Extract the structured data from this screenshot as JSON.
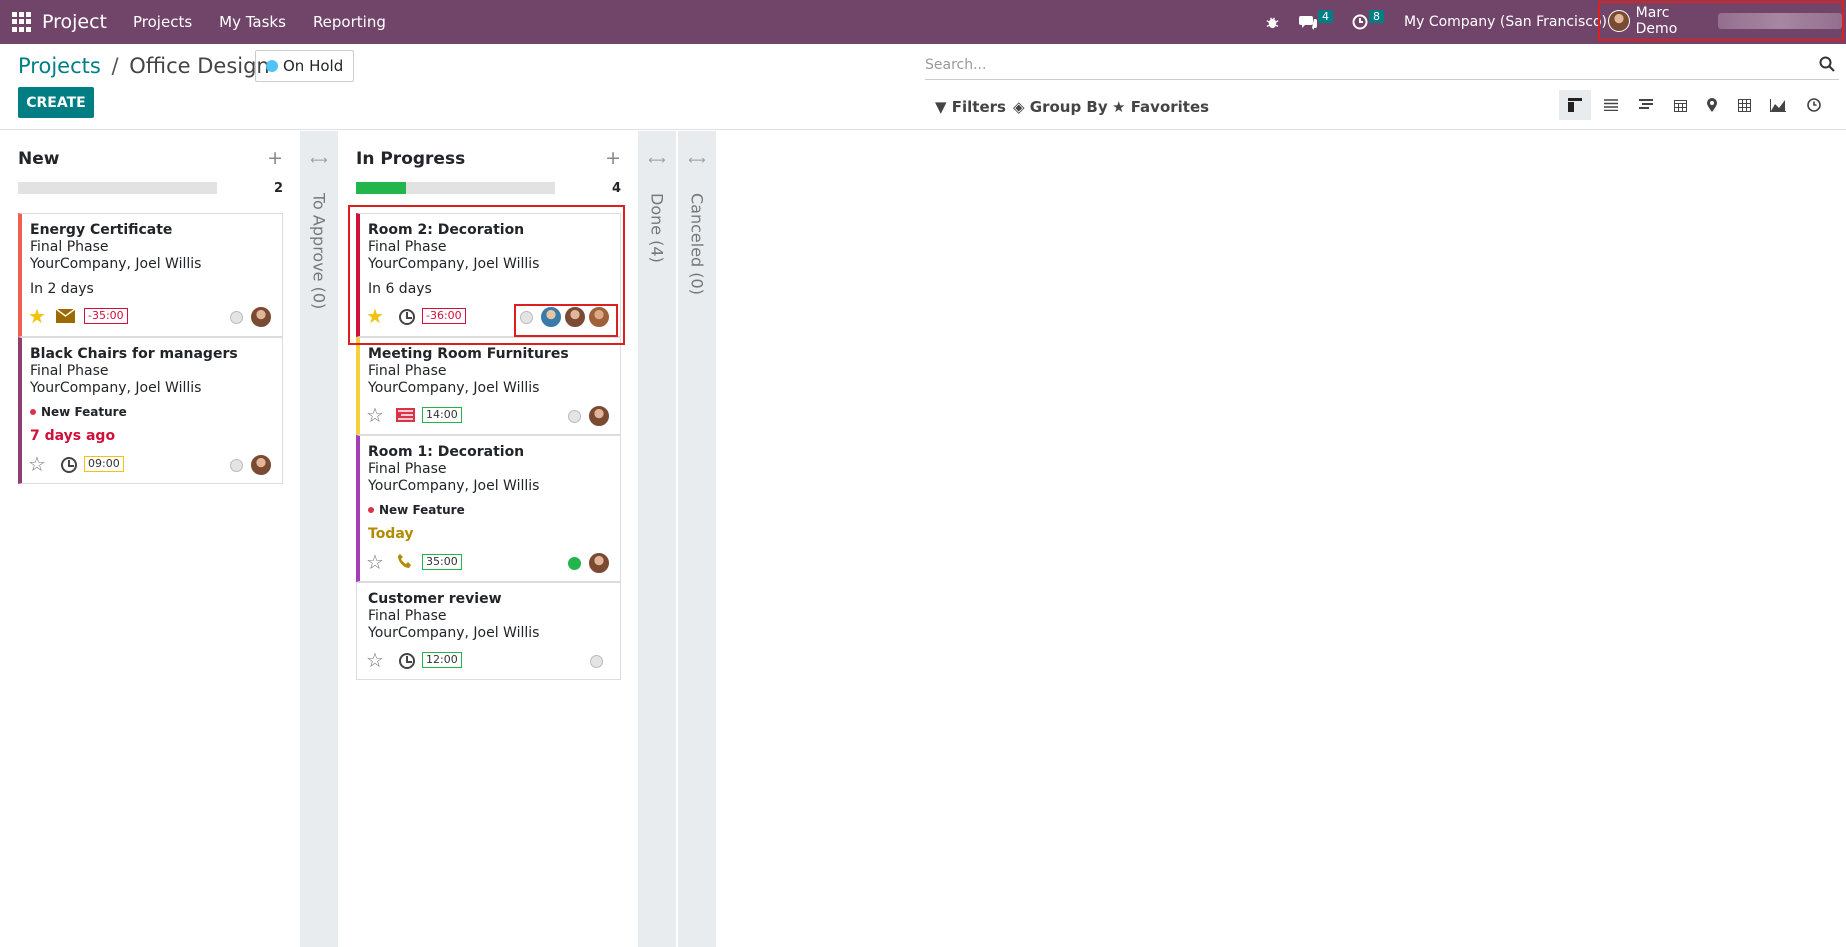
{
  "topbar": {
    "app_name": "Project",
    "menu": [
      "Projects",
      "My Tasks",
      "Reporting"
    ],
    "messages_count": "4",
    "activities_count": "8",
    "company": "My Company (San Francisco)",
    "user": "Marc Demo"
  },
  "control_panel": {
    "breadcrumb_root": "Projects",
    "breadcrumb_sep": "/",
    "breadcrumb_current": "Office Design",
    "status": "On Hold",
    "status_color": "#4fc3f7",
    "create_label": "CREATE",
    "search_placeholder": "Search...",
    "filters_label": "Filters",
    "groupby_label": "Group By",
    "favorites_label": "Favorites",
    "views": [
      "kanban",
      "list",
      "gantt",
      "calendar",
      "map",
      "pivot",
      "graph",
      "activity"
    ]
  },
  "columns": [
    {
      "title": "New",
      "count": "2",
      "progress_green_pct": 0
    },
    {
      "title": "To Approve (0)",
      "folded": true
    },
    {
      "title": "In Progress",
      "count": "4",
      "progress_green_pct": 25
    },
    {
      "title": "Done (4)",
      "folded": true
    },
    {
      "title": "Canceled (0)",
      "folded": true
    }
  ],
  "cards": {
    "energy": {
      "title": "Energy Certificate",
      "phase": "Final Phase",
      "assignees": "YourCompany, Joel Willis",
      "deadline": "In 2 days",
      "hours": "-35:00",
      "color": "#f06050"
    },
    "chairs": {
      "title": "Black Chairs for managers",
      "phase": "Final Phase",
      "assignees": "YourCompany, Joel Willis",
      "tag": "New Feature",
      "deadline": "7 days ago",
      "hours": "09:00",
      "color": "#8e3f6f"
    },
    "room2": {
      "title": "Room 2: Decoration",
      "phase": "Final Phase",
      "assignees": "YourCompany, Joel Willis",
      "deadline": "In 6 days",
      "hours": "-36:00",
      "color": "#d0103a"
    },
    "meeting": {
      "title": "Meeting Room Furnitures",
      "phase": "Final Phase",
      "assignees": "YourCompany, Joel Willis",
      "hours": "14:00",
      "color": "#f4d03f"
    },
    "room1": {
      "title": "Room 1: Decoration",
      "phase": "Final Phase",
      "assignees": "YourCompany, Joel Willis",
      "tag": "New Feature",
      "deadline": "Today",
      "hours": "35:00",
      "color": "#a63db8"
    },
    "review": {
      "title": "Customer review",
      "phase": "Final Phase",
      "assignees": "YourCompany, Joel Willis",
      "hours": "12:00",
      "color": "#ffffff"
    }
  }
}
